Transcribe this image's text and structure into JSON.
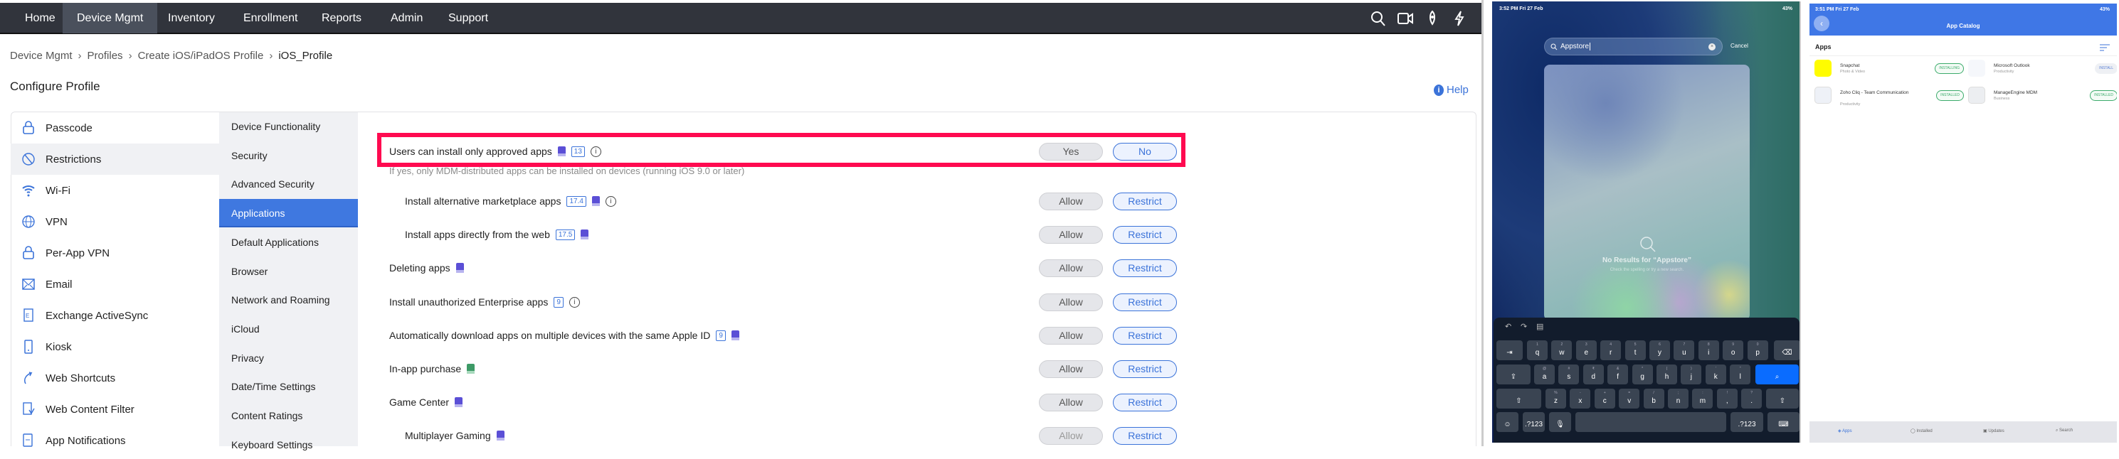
{
  "nav": {
    "items": [
      "Home",
      "Device Mgmt",
      "Inventory",
      "Enrollment",
      "Reports",
      "Admin",
      "Support"
    ],
    "active": 1
  },
  "breadcrumb": [
    "Device Mgmt",
    "Profiles",
    "Create iOS/iPadOS Profile",
    "iOS_Profile"
  ],
  "page_title": "Configure Profile",
  "help": "Help",
  "sidebar": {
    "items": [
      "Passcode",
      "Restrictions",
      "Wi-Fi",
      "VPN",
      "Per-App VPN",
      "Email",
      "Exchange ActiveSync",
      "Kiosk",
      "Web Shortcuts",
      "Web Content Filter",
      "App Notifications"
    ],
    "selected": 1
  },
  "subnav": {
    "items": [
      "Device Functionality",
      "Security",
      "Advanced Security",
      "Applications",
      "Default Applications",
      "Browser",
      "Network and Roaming",
      "iCloud",
      "Privacy",
      "Date/Time Settings",
      "Content Ratings",
      "Keyboard Settings"
    ],
    "selected": 3
  },
  "settings": [
    {
      "label": "Users can install only approved apps",
      "version": "13",
      "device": "purple",
      "info": true,
      "options": [
        "Yes",
        "No"
      ],
      "selected": 1,
      "indent": false,
      "highlighted": true,
      "description": "If yes, only MDM-distributed apps can be installed on devices (running iOS 9.0 or later)"
    },
    {
      "label": "Install alternative marketplace apps",
      "version": "17.4",
      "device": "purple",
      "info": true,
      "options": [
        "Allow",
        "Restrict"
      ],
      "selected": 1,
      "indent": true
    },
    {
      "label": "Install apps directly from the web",
      "version": "17.5",
      "device": "purple",
      "info": false,
      "options": [
        "Allow",
        "Restrict"
      ],
      "selected": 1,
      "indent": true
    },
    {
      "label": "Deleting apps",
      "version": null,
      "device": "purple",
      "info": false,
      "options": [
        "Allow",
        "Restrict"
      ],
      "selected": 1,
      "indent": false
    },
    {
      "label": "Install unauthorized Enterprise apps",
      "version": "9",
      "device": null,
      "info": true,
      "options": [
        "Allow",
        "Restrict"
      ],
      "selected": 1,
      "indent": false
    },
    {
      "label": "Automatically download apps on multiple devices with the same Apple ID",
      "version": "9",
      "device": "purple",
      "info": false,
      "options": [
        "Allow",
        "Restrict"
      ],
      "selected": 1,
      "indent": false
    },
    {
      "label": "In-app purchase",
      "version": null,
      "device": "green",
      "info": false,
      "options": [
        "Allow",
        "Restrict"
      ],
      "selected": 1,
      "indent": false
    },
    {
      "label": "Game Center",
      "version": null,
      "device": "purple",
      "info": false,
      "options": [
        "Allow",
        "Restrict"
      ],
      "selected": 1,
      "indent": false
    },
    {
      "label": "Multiplayer Gaming",
      "version": null,
      "device": "purple",
      "info": false,
      "options": [
        "Allow",
        "Restrict"
      ],
      "selected": 1,
      "indent": true,
      "disabled": true
    }
  ],
  "ipad_search": {
    "time": "3:52 PM  Fri 27 Feb",
    "battery": "43%",
    "query": "Appstore",
    "cancel": "Cancel",
    "no_results": "No Results for “Appstore”",
    "hint": "Check the spelling or try a new search.",
    "keyboard": {
      "row1": [
        [
          "1",
          "q"
        ],
        [
          "2",
          "w"
        ],
        [
          "3",
          "e"
        ],
        [
          "4",
          "r"
        ],
        [
          "5",
          "t"
        ],
        [
          "6",
          "y"
        ],
        [
          "7",
          "u"
        ],
        [
          "8",
          "i"
        ],
        [
          "9",
          "o"
        ],
        [
          "0",
          "p"
        ]
      ],
      "row2": [
        [
          "@",
          "a"
        ],
        [
          "#",
          "s"
        ],
        [
          "₹",
          "d"
        ],
        [
          "&",
          "f"
        ],
        [
          "*",
          "g"
        ],
        [
          "(",
          "h"
        ],
        [
          ")",
          "j"
        ],
        [
          "'",
          "k"
        ],
        [
          "\"",
          "l"
        ]
      ],
      "row3": [
        [
          "%",
          "z"
        ],
        [
          "-",
          "x"
        ],
        [
          "+",
          "c"
        ],
        [
          "=",
          "v"
        ],
        [
          "/",
          "b"
        ],
        [
          ";",
          "n"
        ],
        [
          ":",
          "m"
        ],
        [
          "!",
          ","
        ],
        [
          "?",
          "."
        ]
      ],
      "numkey": ".?123"
    }
  },
  "app_catalog": {
    "time": "3:51 PM  Fri 27 Feb",
    "battery": "43%",
    "title": "App Catalog",
    "section": "Apps",
    "apps": [
      {
        "name": "Snapchat",
        "category": "Photo & Video",
        "status": "INSTALLING",
        "style": "g",
        "color": "#fffc00"
      },
      {
        "name": "Microsoft Outlook",
        "category": "Productivity",
        "status": "INSTALL",
        "style": "b",
        "color": "#f5f7fb"
      },
      {
        "name": "Zoho Cliq - Team Communication",
        "category": "Productivity",
        "status": "INSTALLED",
        "style": "g",
        "color": "#eef1f7"
      },
      {
        "name": "ManageEngine MDM",
        "category": "Business",
        "status": "INSTALLED",
        "style": "g",
        "color": "#eceef1"
      }
    ],
    "tabs": [
      "Apps",
      "Installed",
      "Updates",
      "Search"
    ],
    "active_tab": 0
  }
}
